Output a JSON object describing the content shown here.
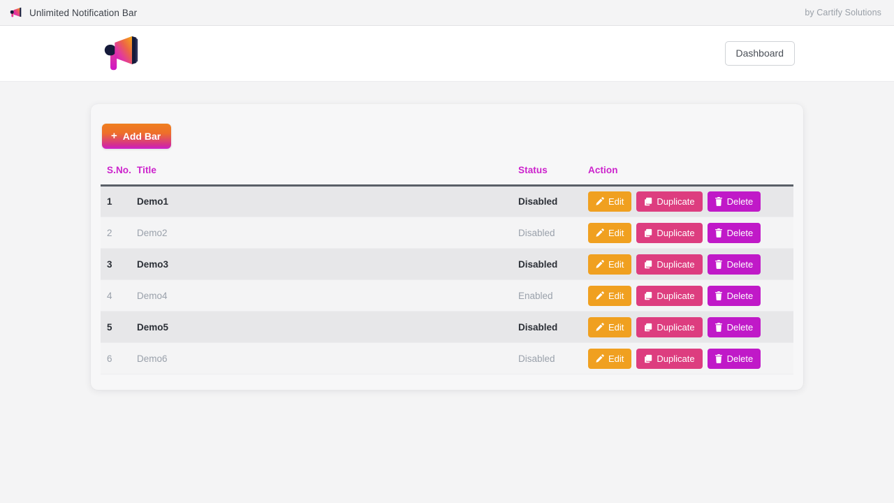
{
  "appbar": {
    "icon": "megaphone-icon",
    "title": "Unlimited Notification Bar",
    "credit": "by Cartify Solutions"
  },
  "header": {
    "logo": "megaphone-logo",
    "dashboard_label": "Dashboard"
  },
  "toolbar": {
    "add_bar_label": "Add Bar",
    "add_bar_plus": "+"
  },
  "table": {
    "columns": [
      {
        "key": "sno",
        "label": "S.No."
      },
      {
        "key": "title",
        "label": "Title"
      },
      {
        "key": "status",
        "label": "Status"
      },
      {
        "key": "action",
        "label": "Action"
      }
    ],
    "rows": [
      {
        "sno": "1",
        "title": "Demo1",
        "status": "Disabled"
      },
      {
        "sno": "2",
        "title": "Demo2",
        "status": "Disabled"
      },
      {
        "sno": "3",
        "title": "Demo3",
        "status": "Disabled"
      },
      {
        "sno": "4",
        "title": "Demo4",
        "status": "Enabled"
      },
      {
        "sno": "5",
        "title": "Demo5",
        "status": "Disabled"
      },
      {
        "sno": "6",
        "title": "Demo6",
        "status": "Disabled"
      }
    ],
    "actions": {
      "edit_label": "Edit",
      "duplicate_label": "Duplicate",
      "delete_label": "Delete",
      "edit_icon": "pencil-icon",
      "duplicate_icon": "copy-icon",
      "delete_icon": "trash-icon"
    }
  },
  "colors": {
    "brand_magenta": "#cc22cc",
    "brand_orange": "#ef7f1f",
    "edit_orange": "#f0a020",
    "duplicate_pink": "#dd3d7f",
    "delete_purple": "#c019c8",
    "page_bg": "#f4f4f5",
    "row_odd_bg": "#e7e7e9",
    "row_even_bg": "#f4f4f5"
  }
}
